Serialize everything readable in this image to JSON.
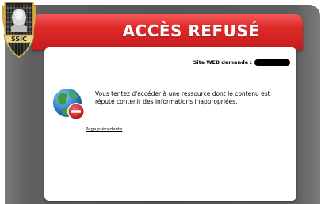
{
  "banner": {
    "title": "ACCÈS REFUSÉ"
  },
  "logo": {
    "text": "SSIC"
  },
  "site": {
    "label": "Site WEB demandé :"
  },
  "message": {
    "text": "Vous tentez d'accéder à une ressource dont le contenu est réputé contenir des informations inappropriées."
  },
  "links": {
    "back": "Page précédente"
  },
  "icons": {
    "logo": "ssic-emblem-icon",
    "blocked": "globe-no-entry-icon"
  },
  "colors": {
    "banner": "#d62324",
    "frame": "#5a5a5a",
    "panel": "#ffffff"
  }
}
